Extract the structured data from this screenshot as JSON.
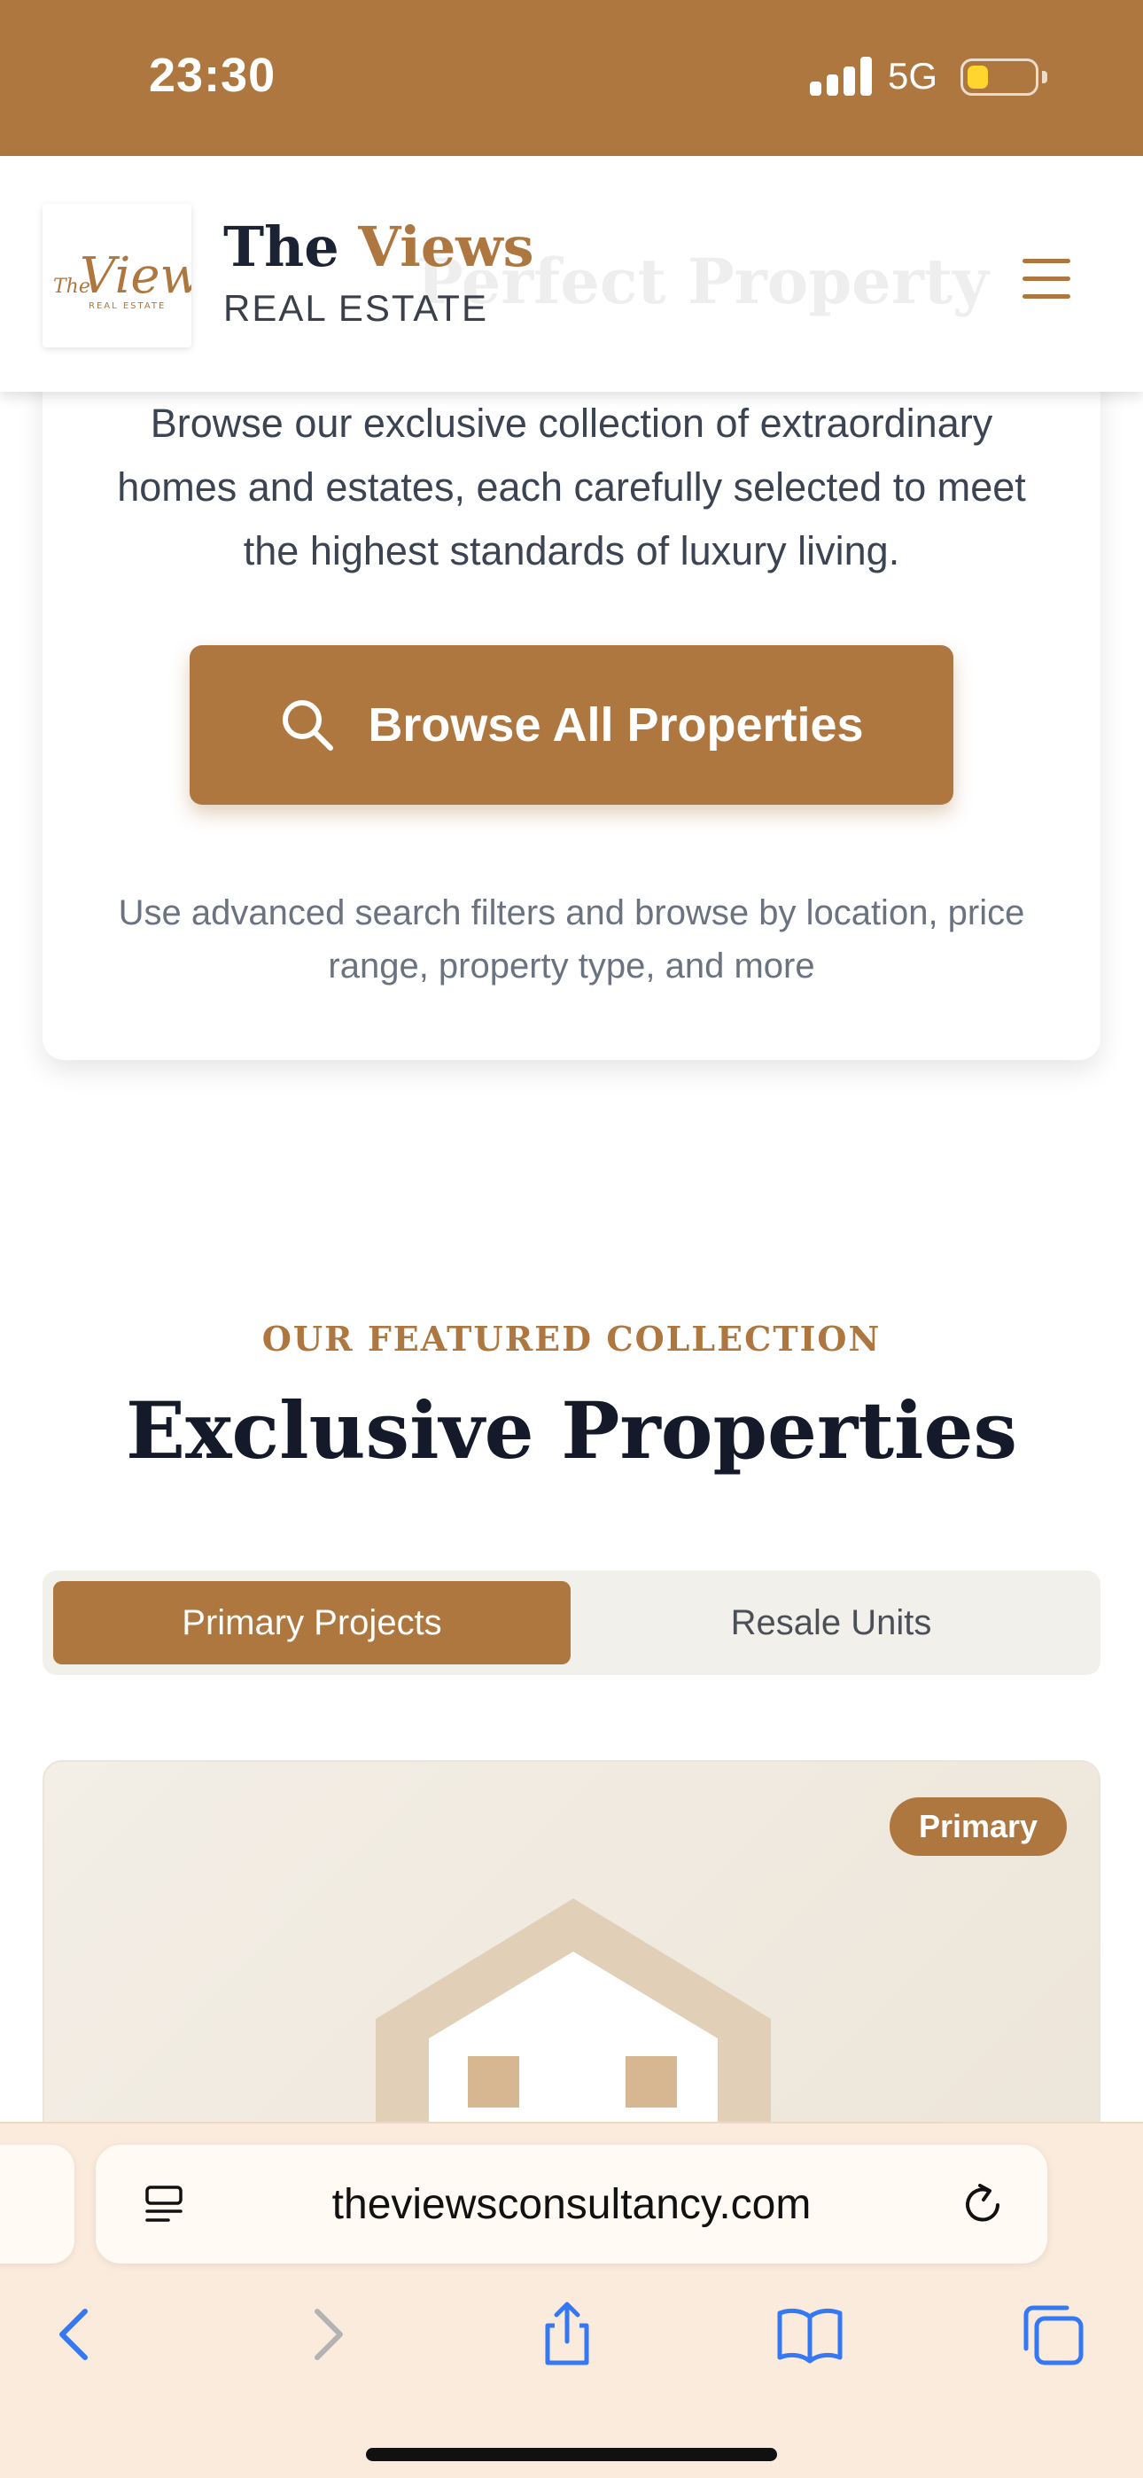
{
  "status_bar": {
    "time": "23:30",
    "network": "5G",
    "battery_level": 0.3
  },
  "header": {
    "logo_script": "Views",
    "logo_prefix": "The",
    "logo_sub": "REAL ESTATE",
    "brand_name_part1": "The",
    "brand_name_part2": "Views",
    "brand_sub": "REAL ESTATE",
    "ghost_heading": "Perfect Property"
  },
  "hero": {
    "description": "Browse our exclusive collection of extraordinary homes and estates, each carefully selected to meet the highest standards of luxury living.",
    "browse_button_label": "Browse All Properties",
    "note": "Use advanced search filters and browse by location, price range, property type, and more"
  },
  "featured": {
    "eyebrow": "OUR FEATURED COLLECTION",
    "title": "Exclusive Properties",
    "tabs": [
      {
        "label": "Primary Projects",
        "active": true
      },
      {
        "label": "Resale Units",
        "active": false
      }
    ],
    "card_badge": "Primary"
  },
  "browser": {
    "url": "theviewsconsultancy.com"
  },
  "colors": {
    "accent": "#ad773f",
    "safari_bar": "#fbebdc",
    "ios_blue": "#3478f6"
  }
}
